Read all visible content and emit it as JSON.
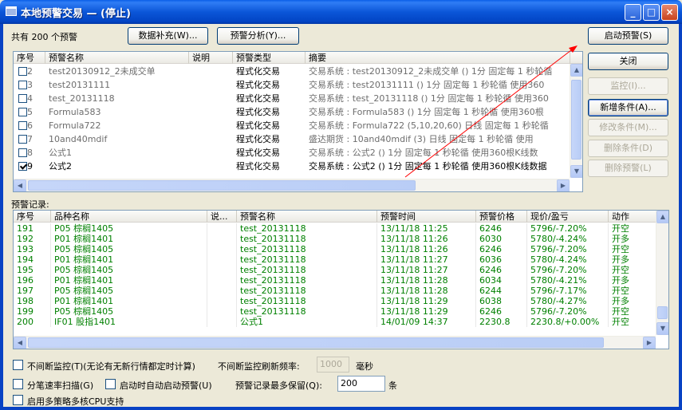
{
  "window": {
    "title": "本地预警交易 — (停止)",
    "minimize": "_",
    "maximize": "□",
    "close": "×"
  },
  "toolbar": {
    "count_label": "共有 200 个预警",
    "data_supplement": "数据补充(W)...",
    "alert_analysis": "预警分析(Y)..."
  },
  "right_buttons": {
    "start_alert": "启动预警(S)",
    "close": "关闭",
    "monitor": "监控(I)...",
    "add_condition": "新增条件(A)...",
    "modify_condition": "修改条件(M)...",
    "delete_condition": "删除条件(D)",
    "delete_alert": "删除预警(L)"
  },
  "alerts_table": {
    "headers": [
      "序号",
      "预警名称",
      "说明",
      "预警类型",
      "摘要"
    ],
    "rows": [
      {
        "no": "2",
        "name": "test20130912_2未成交单",
        "desc": "",
        "type": "程式化交易",
        "summary": "交易系统 : test20130912_2未成交单 () 1分 固定每 1 秒轮循",
        "checked": false
      },
      {
        "no": "3",
        "name": "test20131111",
        "desc": "",
        "type": "程式化交易",
        "summary": "交易系统 : test20131111 () 1分 固定每 1 秒轮循 使用360",
        "checked": false
      },
      {
        "no": "4",
        "name": "test_20131118",
        "desc": "",
        "type": "程式化交易",
        "summary": "交易系统 : test_20131118 () 1分 固定每 1 秒轮循 使用360",
        "checked": false
      },
      {
        "no": "5",
        "name": "Formula583",
        "desc": "",
        "type": "程式化交易",
        "summary": "交易系统 : Formula583 () 1分 固定每 1 秒轮循 使用360根",
        "checked": false
      },
      {
        "no": "6",
        "name": "Formula722",
        "desc": "",
        "type": "程式化交易",
        "summary": "交易系统 : Formula722 (5,10,20,60) 日线 固定每 1 秒轮循",
        "checked": false
      },
      {
        "no": "7",
        "name": "10and40mdif",
        "desc": "",
        "type": "程式化交易",
        "summary": "盛达期货 : 10and40mdif (3) 日线 固定每 1 秒轮循 使用",
        "checked": false
      },
      {
        "no": "8",
        "name": "公式1",
        "desc": "",
        "type": "程式化交易",
        "summary": "交易系统 : 公式2 () 1分 固定每 1 秒轮循 使用360根K线数",
        "checked": false
      },
      {
        "no": "9",
        "name": "公式2",
        "desc": "",
        "type": "程式化交易",
        "summary": "交易系统 : 公式2 () 1分 固定每 1 秒轮循 使用360根K线数据",
        "checked": true
      }
    ]
  },
  "records_label": "预警记录:",
  "records_table": {
    "headers": [
      "序号",
      "品种名称",
      "说...",
      "预警名称",
      "预警时间",
      "预警价格",
      "现价/盈亏",
      "动作"
    ],
    "rows": [
      {
        "no": "191",
        "symbol": "P05 棕榈1405",
        "desc": "",
        "name": "test_20131118",
        "time": "13/11/18 11:25",
        "price": "6246",
        "pnl": "5796/-7.20%",
        "action": "开空"
      },
      {
        "no": "192",
        "symbol": "P01 棕榈1401",
        "desc": "",
        "name": "test_20131118",
        "time": "13/11/18 11:26",
        "price": "6030",
        "pnl": "5780/-4.24%",
        "action": "开多"
      },
      {
        "no": "193",
        "symbol": "P05 棕榈1405",
        "desc": "",
        "name": "test_20131118",
        "time": "13/11/18 11:26",
        "price": "6246",
        "pnl": "5796/-7.20%",
        "action": "开空"
      },
      {
        "no": "194",
        "symbol": "P01 棕榈1401",
        "desc": "",
        "name": "test_20131118",
        "time": "13/11/18 11:27",
        "price": "6036",
        "pnl": "5780/-4.24%",
        "action": "开多"
      },
      {
        "no": "195",
        "symbol": "P05 棕榈1405",
        "desc": "",
        "name": "test_20131118",
        "time": "13/11/18 11:27",
        "price": "6246",
        "pnl": "5796/-7.20%",
        "action": "开空"
      },
      {
        "no": "196",
        "symbol": "P01 棕榈1401",
        "desc": "",
        "name": "test_20131118",
        "time": "13/11/18 11:28",
        "price": "6034",
        "pnl": "5780/-4.21%",
        "action": "开多"
      },
      {
        "no": "197",
        "symbol": "P05 棕榈1405",
        "desc": "",
        "name": "test_20131118",
        "time": "13/11/18 11:28",
        "price": "6244",
        "pnl": "5796/-7.17%",
        "action": "开空"
      },
      {
        "no": "198",
        "symbol": "P01 棕榈1401",
        "desc": "",
        "name": "test_20131118",
        "time": "13/11/18 11:29",
        "price": "6038",
        "pnl": "5780/-4.27%",
        "action": "开多"
      },
      {
        "no": "199",
        "symbol": "P05 棕榈1405",
        "desc": "",
        "name": "test_20131118",
        "time": "13/11/18 11:29",
        "price": "6246",
        "pnl": "5796/-7.20%",
        "action": "开空"
      },
      {
        "no": "200",
        "symbol": "IF01 股指1401",
        "desc": "",
        "name": "公式1",
        "time": "14/01/09 14:37",
        "price": "2230.8",
        "pnl": "2230.8/+0.00%",
        "action": "开空"
      }
    ]
  },
  "options": {
    "continuous_monitor": "不间断监控(T)(无论有无新行情都定时计算)",
    "refresh_rate_label": "不间断监控刷新频率:",
    "refresh_rate_value": "1000",
    "refresh_rate_unit": "毫秒",
    "tick_scan": "分笔速率扫描(G)",
    "auto_start": "启动时自动启动预警(U)",
    "max_records_label": "预警记录最多保留(Q):",
    "max_records_value": "200",
    "max_records_unit": "条",
    "multicore": "启用多策略多核CPU支持"
  },
  "colors": {
    "title_bar": "#0b56d8",
    "record_text": "#008000",
    "arrow": "#ff0000"
  }
}
